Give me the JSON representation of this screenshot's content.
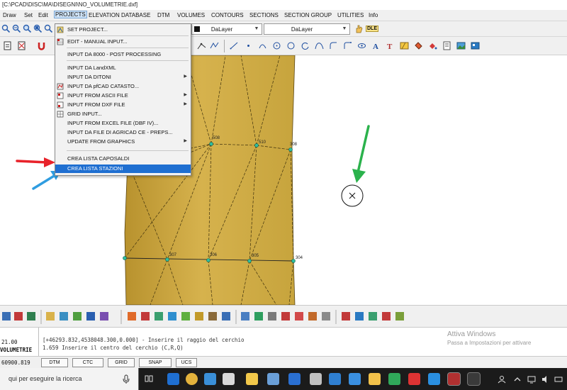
{
  "app": {
    "title": "[C:\\PCAD\\DISC\\MA\\DISEGNI\\NO_VOLUMETRIE.dxf]"
  },
  "menubar": {
    "items": [
      "Draw",
      "Set",
      "Edit",
      "PROJECTS",
      "ELEVATION DATABASE",
      "DTM",
      "VOLUMES",
      "CONTOURS",
      "SECTIONS",
      "SECTION GROUP",
      "UTILITIES",
      "Info"
    ],
    "active": "PROJECTS"
  },
  "toolbar": {
    "layer_combo": "DaLayer",
    "linetype_combo": "DaLayer",
    "dle_label": "DLE"
  },
  "projects_menu": {
    "items": [
      {
        "label": "SET PROJECT...",
        "icon": "set-project-icon"
      },
      {
        "label": "EDIT - MANUAL INPUT...",
        "icon": "edit-grid-icon"
      },
      {
        "label": "INPUT DA 8000 - POST PROCESSING"
      },
      {
        "label": "INPUT DA LandXML"
      },
      {
        "label": "INPUT DA DITONI",
        "submenu": true
      },
      {
        "label": "INPUT DA pfCAD CATASTO...",
        "icon": "catasto-icon"
      },
      {
        "label": "INPUT FROM ASCII FILE",
        "icon": "ascii-file-icon",
        "submenu": true
      },
      {
        "label": "INPUT FROM DXF FILE",
        "icon": "dxf-file-icon",
        "submenu": true
      },
      {
        "label": "GRID INPUT...",
        "icon": "grid-input-icon"
      },
      {
        "label": "INPUT FROM EXCEL FILE (DBF IV)..."
      },
      {
        "label": "INPUT DA FILE DI AGRICAD CE - PREPS..."
      },
      {
        "label": "UPDATE FROM GRAPHICS",
        "submenu": true
      },
      {
        "label": "CREA LISTA CAPOSALDI"
      },
      {
        "label": "CREA LISTA STAZIONI",
        "highlighted": true
      }
    ]
  },
  "drawing": {
    "point_labels": [
      "510",
      "508",
      "308",
      "307",
      "306",
      "305",
      "304"
    ]
  },
  "command": {
    "left_top": "21.00",
    "left_label": "VOLUMETRIE",
    "line1": "[+46293.832,4538048.300,0.000] - Inserire il raggio del cerchio",
    "line2": "1.659   Inserire il centro del cerchio (C,R,Q)"
  },
  "watermark": {
    "title": "Attiva Windows",
    "subtitle": "Passa a Impostazioni per attivare"
  },
  "statusbar": {
    "coord": "60900.819",
    "buttons": [
      "DTM",
      "CTC",
      "GRID",
      "SNAP",
      "UCS"
    ]
  },
  "taskbar": {
    "search_placeholder": "qui per eseguire la ricerca"
  },
  "colors": {
    "terrain": "#c9a640",
    "terrain_dark": "#a6842a",
    "highlight": "#1f6fd1",
    "red_arrow": "#e8222a",
    "blue_arrow": "#2f9de0",
    "green_arrow": "#2bb24c"
  }
}
